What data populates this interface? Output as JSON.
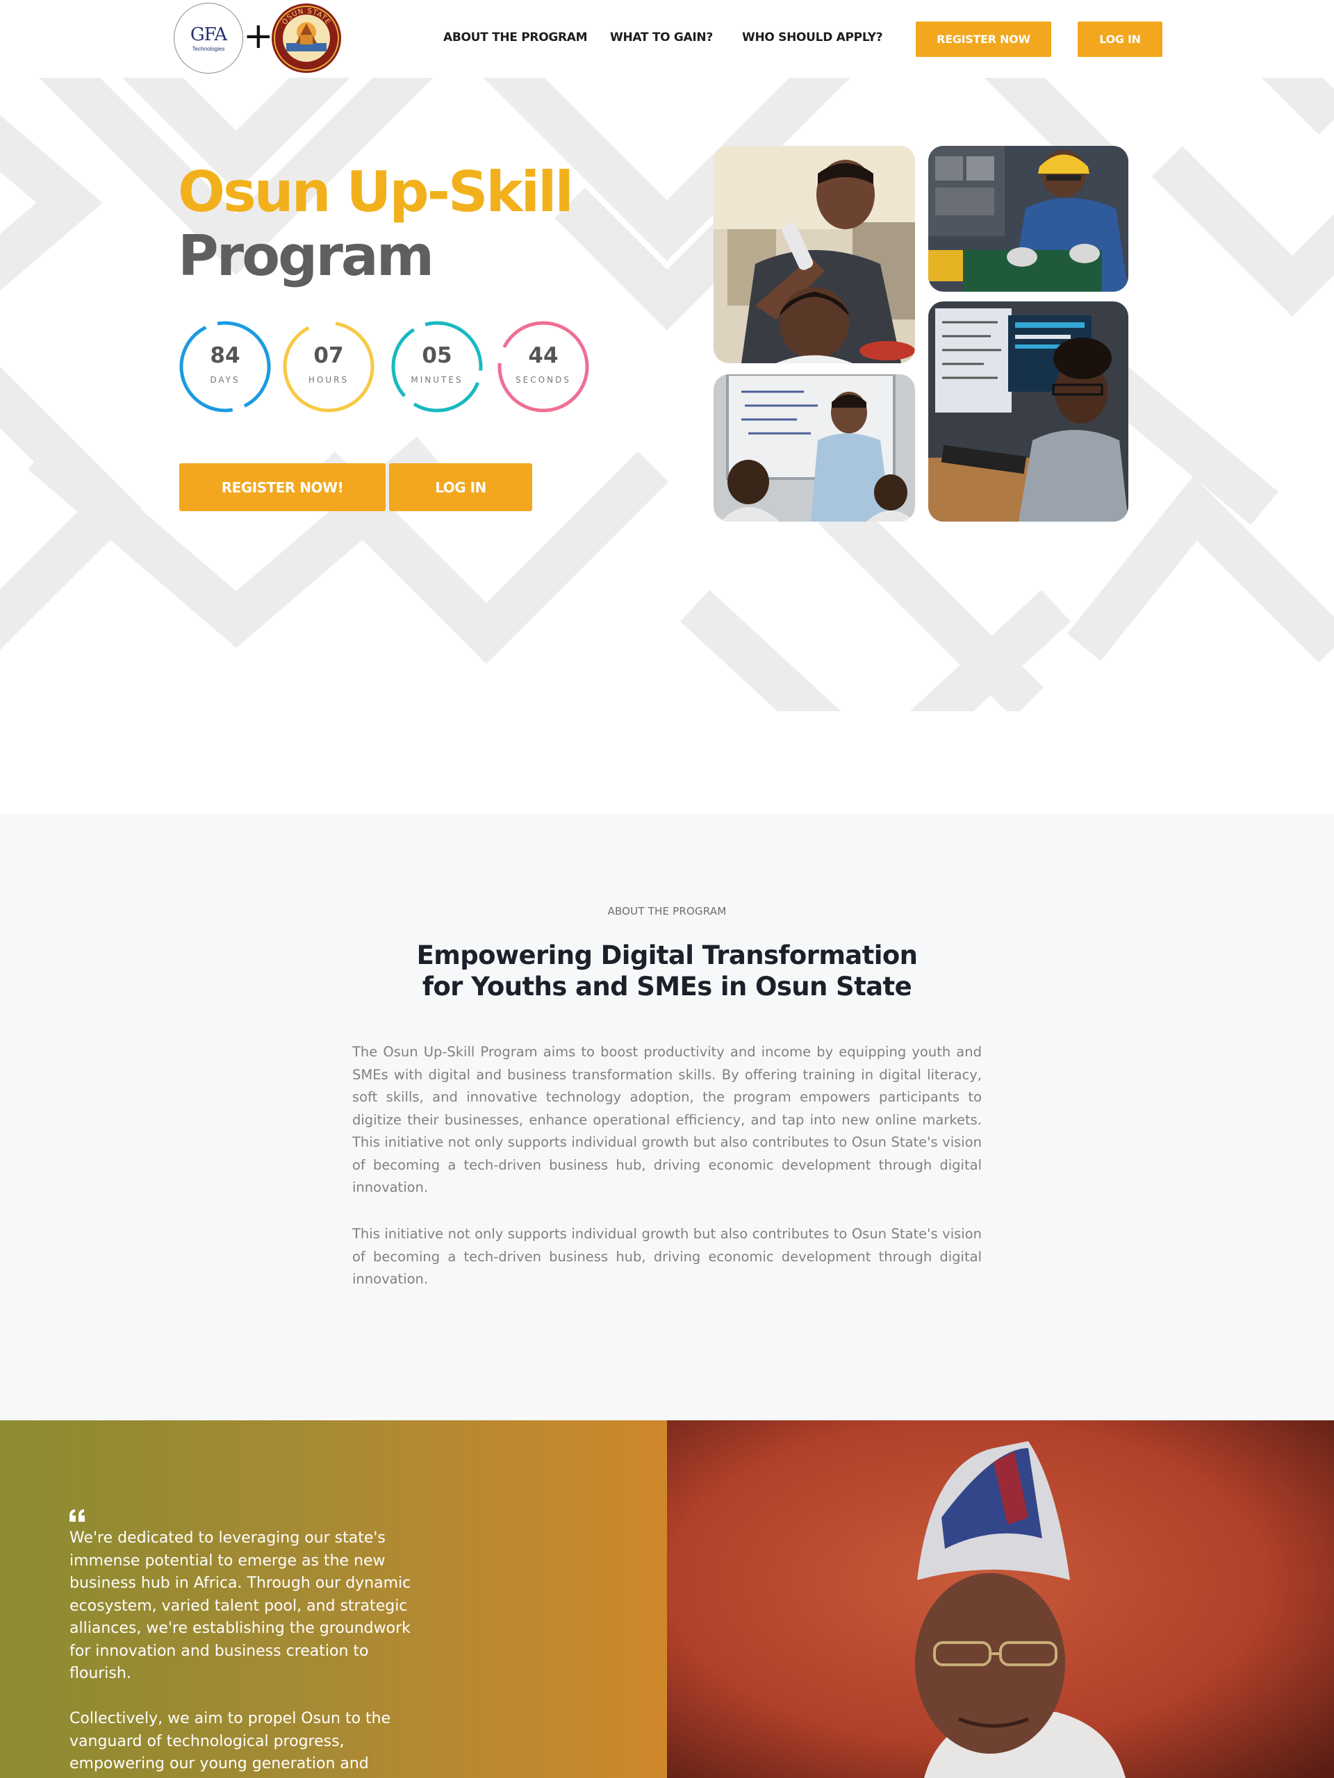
{
  "brand": {
    "partner_logo_text": "GFA",
    "partner_logo_subtext": "Technologies",
    "seal_text": "OSUN STATE"
  },
  "nav": {
    "links": [
      "ABOUT THE PROGRAM",
      "WHAT TO GAIN?",
      "WHO SHOULD APPLY?"
    ],
    "register_label": "REGISTER NOW",
    "login_label": "LOG IN"
  },
  "hero": {
    "title_line1": "Osun Up-Skill",
    "title_line2": "Program",
    "countdown": [
      {
        "value": "84",
        "unit": "DAYS",
        "color": "#1a9be0"
      },
      {
        "value": "07",
        "unit": "HOURS",
        "color": "#f7c945"
      },
      {
        "value": "05",
        "unit": "MINUTES",
        "color": "#19b9c1"
      },
      {
        "value": "44",
        "unit": "SECONDS",
        "color": "#ef6f94"
      }
    ],
    "register_label": "REGISTER NOW!",
    "login_label": "LOG IN",
    "photos": [
      "barber-photo",
      "electronics-technician-photo",
      "classroom-teacher-photo",
      "developer-at-computer-photo"
    ]
  },
  "about": {
    "eyebrow": "ABOUT THE PROGRAM",
    "heading_line1": "Empowering Digital Transformation",
    "heading_line2": "for Youths and SMEs in Osun State",
    "paragraph1": "The Osun Up-Skill Program aims to boost productivity and income by equipping youth and SMEs with digital and business transformation skills. By offering training in digital literacy, soft skills, and innovative technology adoption, the program empowers participants to digitize their businesses, enhance operational efficiency, and tap into new online markets. This initiative not only supports individual growth but also contributes to Osun State's vision of becoming a tech-driven business hub, driving economic development through digital innovation.",
    "paragraph2": "This initiative not only supports individual growth but also contributes to Osun State's vision of becoming a tech-driven business hub, driving economic development through digital innovation."
  },
  "quote": {
    "paragraph1": "We're dedicated to leveraging our state's immense potential to emerge as the new business hub in Africa. Through our dynamic ecosystem, varied talent pool, and strategic alliances, we're establishing the groundwork for innovation and business creation to flourish.",
    "paragraph2": "Collectively, we aim to propel Osun to the vanguard of technological progress, empowering our young generation and"
  },
  "colors": {
    "accent": "#f2a71e",
    "title_yellow": "#f2b11c",
    "title_grey": "#5f5f5f",
    "about_bg": "#f7f8fa"
  }
}
